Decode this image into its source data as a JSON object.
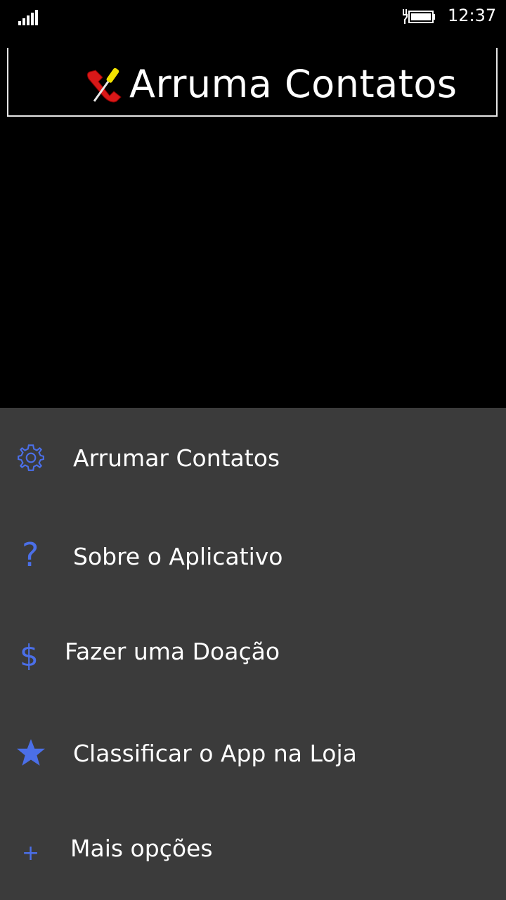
{
  "status_bar": {
    "time": "12:37",
    "signal_icon": "signal-bars-icon",
    "battery_icon": "battery-charging-icon"
  },
  "header": {
    "title": "Arruma Contatos",
    "logo_icon": "phone-screwdriver-logo"
  },
  "menu": {
    "accent_color": "#4b6fe8",
    "background_color": "#3b3b3b",
    "items": [
      {
        "label": "Arrumar Contatos",
        "icon": "gear-icon"
      },
      {
        "label": "Sobre o Aplicativo",
        "icon": "question-icon"
      },
      {
        "label": "Fazer uma Doação",
        "icon": "dollar-icon"
      },
      {
        "label": "Classificar o App na Loja",
        "icon": "star-icon"
      },
      {
        "label": "Mais opções",
        "icon": "plus-icon"
      }
    ]
  }
}
